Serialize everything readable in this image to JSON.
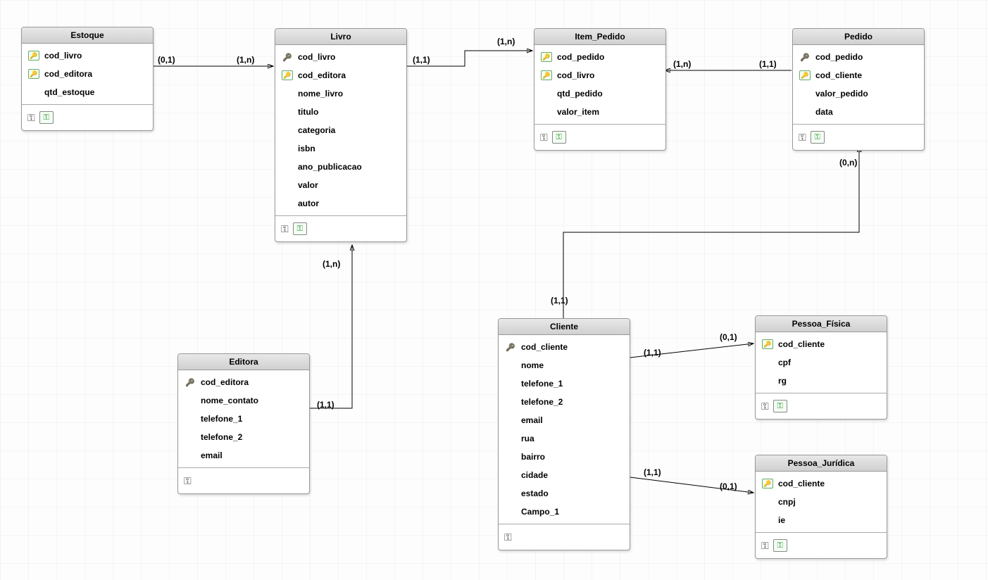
{
  "entities": {
    "estoque": {
      "title": "Estoque",
      "attributes": [
        {
          "name": "cod_livro",
          "key": "fk"
        },
        {
          "name": "cod_editora",
          "key": "fk"
        },
        {
          "name": "qtd_estoque",
          "key": ""
        }
      ],
      "footer_icons": [
        "hkey",
        "greenbadge"
      ]
    },
    "livro": {
      "title": "Livro",
      "attributes": [
        {
          "name": "cod_livro",
          "key": "pk"
        },
        {
          "name": "cod_editora",
          "key": "fk"
        },
        {
          "name": "nome_livro",
          "key": ""
        },
        {
          "name": "titulo",
          "key": ""
        },
        {
          "name": "categoria",
          "key": ""
        },
        {
          "name": "isbn",
          "key": ""
        },
        {
          "name": "ano_publicacao",
          "key": ""
        },
        {
          "name": "valor",
          "key": ""
        },
        {
          "name": "autor",
          "key": ""
        }
      ],
      "footer_icons": [
        "hkey",
        "greenbadge"
      ]
    },
    "item_pedido": {
      "title": "Item_Pedido",
      "attributes": [
        {
          "name": "cod_pedido",
          "key": "fk"
        },
        {
          "name": "cod_livro",
          "key": "fk"
        },
        {
          "name": "qtd_pedido",
          "key": ""
        },
        {
          "name": "valor_item",
          "key": ""
        }
      ],
      "footer_icons": [
        "hkey",
        "greenbadge"
      ]
    },
    "pedido": {
      "title": "Pedido",
      "attributes": [
        {
          "name": "cod_pedido",
          "key": "pk"
        },
        {
          "name": "cod_cliente",
          "key": "fk"
        },
        {
          "name": "valor_pedido",
          "key": ""
        },
        {
          "name": "data",
          "key": ""
        }
      ],
      "footer_icons": [
        "hkey",
        "greenbadge"
      ]
    },
    "editora": {
      "title": "Editora",
      "attributes": [
        {
          "name": "cod_editora",
          "key": "pk"
        },
        {
          "name": "nome_contato",
          "key": ""
        },
        {
          "name": "telefone_1",
          "key": ""
        },
        {
          "name": "telefone_2",
          "key": ""
        },
        {
          "name": "email",
          "key": ""
        }
      ],
      "footer_icons": [
        "hkey"
      ]
    },
    "cliente": {
      "title": "Cliente",
      "attributes": [
        {
          "name": "cod_cliente",
          "key": "pk"
        },
        {
          "name": "nome",
          "key": ""
        },
        {
          "name": "telefone_1",
          "key": ""
        },
        {
          "name": "telefone_2",
          "key": ""
        },
        {
          "name": "email",
          "key": ""
        },
        {
          "name": "rua",
          "key": ""
        },
        {
          "name": "bairro",
          "key": ""
        },
        {
          "name": "cidade",
          "key": ""
        },
        {
          "name": "estado",
          "key": ""
        },
        {
          "name": "Campo_1",
          "key": ""
        }
      ],
      "footer_icons": [
        "hkey"
      ]
    },
    "pessoa_fisica": {
      "title": "Pessoa_Física",
      "attributes": [
        {
          "name": "cod_cliente",
          "key": "fk"
        },
        {
          "name": "cpf",
          "key": ""
        },
        {
          "name": "rg",
          "key": ""
        }
      ],
      "footer_icons": [
        "hkey",
        "greenbadge"
      ]
    },
    "pessoa_juridica": {
      "title": "Pessoa_Jurídica",
      "attributes": [
        {
          "name": "cod_cliente",
          "key": "fk"
        },
        {
          "name": "cnpj",
          "key": ""
        },
        {
          "name": "ie",
          "key": ""
        }
      ],
      "footer_icons": [
        "hkey",
        "greenbadge"
      ]
    }
  },
  "cardinalities": {
    "estoque_livro_left": "(0,1)",
    "estoque_livro_right": "(1,n)",
    "livro_item_left": "(1,1)",
    "livro_item_right": "(1,n)",
    "item_pedido_left": "(1,n)",
    "item_pedido_right": "(1,1)",
    "editora_livro_bottom": "(1,1)",
    "editora_livro_top": "(1,n)",
    "cliente_pedido_bottom": "(1,1)",
    "cliente_pedido_top": "(0,n)",
    "cliente_pf_left": "(1,1)",
    "cliente_pf_right": "(0,1)",
    "cliente_pj_left": "(1,1)",
    "cliente_pj_right": "(0,1)"
  }
}
